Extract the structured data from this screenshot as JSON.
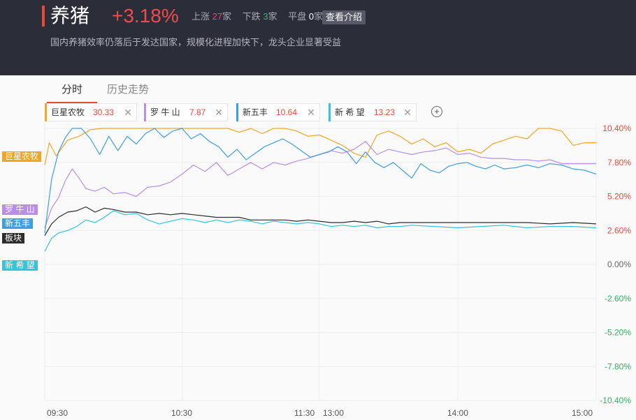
{
  "header": {
    "title": "养猪",
    "change": "+3.18%",
    "stats": {
      "up_label": "上涨",
      "up_count": "27",
      "up_unit": "家",
      "down_label": "下跌",
      "down_count": "3",
      "down_unit": "家",
      "flat_label": "平盘",
      "flat_count": "0",
      "flat_unit": "家"
    },
    "intro_button": "查看介绍",
    "description": "国内养猪效率仍落后于发达国家，规模化进程加快下，龙头企业显著受益"
  },
  "tabs": [
    {
      "label": "分时",
      "active": true
    },
    {
      "label": "历史走势",
      "active": false
    }
  ],
  "chips": [
    {
      "name": "巨星农牧",
      "value": "30.33",
      "color": "#f4a623"
    },
    {
      "name": "罗 牛 山",
      "value": "7.87",
      "color": "#b88ee6"
    },
    {
      "name": "新五丰",
      "value": "10.64",
      "color": "#3d9ee2"
    },
    {
      "name": "新 希 望",
      "value": "13.23",
      "color": "#36c3dc"
    }
  ],
  "add_symbol": "+",
  "close_symbol": "✕",
  "legend": [
    {
      "label": "巨星农牧",
      "color": "#f4a623"
    },
    {
      "label": "罗 牛 山",
      "color": "#b88ee6"
    },
    {
      "label": "新五丰",
      "color": "#3d9ee2"
    },
    {
      "label": "板块",
      "color": "#2d2d2d"
    },
    {
      "label": "新 希 望",
      "color": "#36c3dc"
    }
  ],
  "chart_data": {
    "type": "line",
    "x_ticks": [
      "09:30",
      "10:30",
      "11:30",
      "13:00",
      "14:00",
      "15:00"
    ],
    "y_ticks": [
      "10.40%",
      "7.80%",
      "5.20%",
      "2.60%",
      "0.00%",
      "-2.60%",
      "-5.20%",
      "-7.80%",
      "-10.40%"
    ],
    "ylim": [
      -10.4,
      10.4
    ],
    "grid": true,
    "colors": {
      "positive": "#e84a3a",
      "zero": "#666666",
      "negative": "#2fb164"
    },
    "series": [
      {
        "name": "巨星农牧",
        "color": "#f4a623",
        "points": [
          [
            0,
            7.6
          ],
          [
            2,
            9.3
          ],
          [
            5,
            8.3
          ],
          [
            10,
            9.5
          ],
          [
            15,
            9.8
          ],
          [
            20,
            10.3
          ],
          [
            25,
            10.4
          ],
          [
            30,
            10.4
          ],
          [
            35,
            10.4
          ],
          [
            40,
            10.4
          ],
          [
            45,
            10.4
          ],
          [
            50,
            10.4
          ],
          [
            55,
            10.4
          ],
          [
            60,
            10.4
          ],
          [
            65,
            10.4
          ],
          [
            70,
            10.4
          ],
          [
            75,
            10.4
          ],
          [
            80,
            10.4
          ],
          [
            85,
            10.1
          ],
          [
            90,
            10.4
          ],
          [
            95,
            10.0
          ],
          [
            100,
            10.4
          ],
          [
            105,
            10.4
          ],
          [
            110,
            10.2
          ],
          [
            115,
            9.8
          ],
          [
            120,
            9.9
          ],
          [
            125,
            9.5
          ],
          [
            130,
            9.1
          ],
          [
            135,
            8.5
          ],
          [
            140,
            8.2
          ],
          [
            145,
            9.9
          ],
          [
            150,
            10.2
          ],
          [
            155,
            9.8
          ],
          [
            160,
            9.2
          ],
          [
            165,
            9.6
          ],
          [
            170,
            9.0
          ],
          [
            175,
            9.3
          ],
          [
            180,
            8.6
          ],
          [
            185,
            8.8
          ],
          [
            190,
            8.5
          ],
          [
            195,
            9.2
          ],
          [
            200,
            9.5
          ],
          [
            205,
            9.8
          ],
          [
            210,
            9.6
          ],
          [
            215,
            10.4
          ],
          [
            220,
            10.4
          ],
          [
            225,
            10.2
          ],
          [
            230,
            9.1
          ],
          [
            235,
            9.3
          ],
          [
            240,
            9.3
          ]
        ]
      },
      {
        "name": "罗 牛 山",
        "color": "#b88ee6",
        "points": [
          [
            0,
            2.8
          ],
          [
            3,
            4.3
          ],
          [
            6,
            5.1
          ],
          [
            9,
            6.4
          ],
          [
            12,
            7.3
          ],
          [
            15,
            6.6
          ],
          [
            18,
            5.8
          ],
          [
            22,
            5.6
          ],
          [
            26,
            5.9
          ],
          [
            30,
            5.4
          ],
          [
            35,
            5.5
          ],
          [
            40,
            5.2
          ],
          [
            45,
            5.9
          ],
          [
            50,
            6.0
          ],
          [
            55,
            6.3
          ],
          [
            60,
            6.9
          ],
          [
            65,
            7.6
          ],
          [
            70,
            7.1
          ],
          [
            75,
            7.8
          ],
          [
            80,
            6.8
          ],
          [
            85,
            7.3
          ],
          [
            90,
            7.8
          ],
          [
            95,
            7.3
          ],
          [
            100,
            7.8
          ],
          [
            105,
            7.6
          ],
          [
            110,
            7.9
          ],
          [
            115,
            8.1
          ],
          [
            120,
            8.4
          ],
          [
            125,
            8.7
          ],
          [
            130,
            8.5
          ],
          [
            135,
            8.8
          ],
          [
            140,
            9.4
          ],
          [
            145,
            8.4
          ],
          [
            150,
            8.8
          ],
          [
            155,
            8.6
          ],
          [
            160,
            8.4
          ],
          [
            165,
            8.6
          ],
          [
            170,
            8.7
          ],
          [
            175,
            8.9
          ],
          [
            180,
            8.4
          ],
          [
            185,
            8.5
          ],
          [
            190,
            8.2
          ],
          [
            195,
            8.1
          ],
          [
            200,
            8.1
          ],
          [
            205,
            8.0
          ],
          [
            210,
            8.0
          ],
          [
            215,
            7.9
          ],
          [
            220,
            8.0
          ],
          [
            225,
            7.7
          ],
          [
            230,
            7.7
          ],
          [
            235,
            7.7
          ],
          [
            240,
            7.7
          ]
        ]
      },
      {
        "name": "新五丰",
        "color": "#3d9ee2",
        "points": [
          [
            0,
            2.4
          ],
          [
            3,
            6.5
          ],
          [
            6,
            8.6
          ],
          [
            9,
            9.7
          ],
          [
            12,
            10.4
          ],
          [
            16,
            10.4
          ],
          [
            20,
            9.6
          ],
          [
            24,
            8.4
          ],
          [
            28,
            9.8
          ],
          [
            32,
            8.7
          ],
          [
            36,
            9.8
          ],
          [
            40,
            9.2
          ],
          [
            44,
            10.0
          ],
          [
            48,
            10.4
          ],
          [
            52,
            9.7
          ],
          [
            56,
            10.2
          ],
          [
            60,
            10.4
          ],
          [
            64,
            9.6
          ],
          [
            68,
            10.0
          ],
          [
            72,
            9.4
          ],
          [
            76,
            9.0
          ],
          [
            80,
            8.2
          ],
          [
            84,
            8.8
          ],
          [
            88,
            8.0
          ],
          [
            92,
            8.5
          ],
          [
            96,
            9.0
          ],
          [
            100,
            9.3
          ],
          [
            104,
            9.6
          ],
          [
            108,
            9.2
          ],
          [
            112,
            8.7
          ],
          [
            116,
            8.2
          ],
          [
            120,
            8.4
          ],
          [
            124,
            8.6
          ],
          [
            128,
            9.0
          ],
          [
            132,
            8.6
          ],
          [
            136,
            7.7
          ],
          [
            140,
            8.6
          ],
          [
            144,
            7.8
          ],
          [
            148,
            7.4
          ],
          [
            152,
            7.8
          ],
          [
            156,
            7.2
          ],
          [
            160,
            6.6
          ],
          [
            164,
            7.7
          ],
          [
            168,
            7.2
          ],
          [
            172,
            7.0
          ],
          [
            176,
            7.5
          ],
          [
            180,
            7.7
          ],
          [
            184,
            7.8
          ],
          [
            188,
            7.5
          ],
          [
            192,
            7.3
          ],
          [
            196,
            7.6
          ],
          [
            200,
            7.3
          ],
          [
            205,
            7.4
          ],
          [
            210,
            7.6
          ],
          [
            215,
            7.4
          ],
          [
            220,
            7.7
          ],
          [
            225,
            7.6
          ],
          [
            230,
            7.3
          ],
          [
            235,
            7.2
          ],
          [
            240,
            6.9
          ]
        ]
      },
      {
        "name": "板块",
        "color": "#2d2d2d",
        "points": [
          [
            0,
            2.2
          ],
          [
            3,
            3.1
          ],
          [
            6,
            3.6
          ],
          [
            10,
            4.0
          ],
          [
            14,
            4.1
          ],
          [
            18,
            4.4
          ],
          [
            22,
            4.0
          ],
          [
            26,
            4.3
          ],
          [
            30,
            4.2
          ],
          [
            35,
            4.0
          ],
          [
            40,
            4.0
          ],
          [
            45,
            3.8
          ],
          [
            50,
            3.9
          ],
          [
            55,
            3.8
          ],
          [
            60,
            3.9
          ],
          [
            65,
            3.8
          ],
          [
            70,
            3.7
          ],
          [
            75,
            3.6
          ],
          [
            80,
            3.6
          ],
          [
            85,
            3.6
          ],
          [
            90,
            3.4
          ],
          [
            95,
            3.4
          ],
          [
            100,
            3.4
          ],
          [
            105,
            3.4
          ],
          [
            110,
            3.3
          ],
          [
            115,
            3.4
          ],
          [
            120,
            3.3
          ],
          [
            125,
            3.2
          ],
          [
            130,
            3.2
          ],
          [
            135,
            3.3
          ],
          [
            140,
            3.2
          ],
          [
            145,
            3.3
          ],
          [
            150,
            3.1
          ],
          [
            155,
            3.2
          ],
          [
            160,
            3.2
          ],
          [
            170,
            3.2
          ],
          [
            180,
            3.2
          ],
          [
            190,
            3.2
          ],
          [
            200,
            3.2
          ],
          [
            210,
            3.2
          ],
          [
            220,
            3.1
          ],
          [
            230,
            3.2
          ],
          [
            240,
            3.1
          ]
        ]
      },
      {
        "name": "新 希 望",
        "color": "#36c3dc",
        "points": [
          [
            0,
            1.0
          ],
          [
            3,
            2.0
          ],
          [
            6,
            2.4
          ],
          [
            10,
            2.6
          ],
          [
            14,
            2.9
          ],
          [
            18,
            3.4
          ],
          [
            22,
            3.2
          ],
          [
            26,
            3.6
          ],
          [
            30,
            4.1
          ],
          [
            35,
            3.8
          ],
          [
            40,
            3.9
          ],
          [
            45,
            3.4
          ],
          [
            50,
            3.1
          ],
          [
            55,
            3.3
          ],
          [
            60,
            3.5
          ],
          [
            65,
            3.4
          ],
          [
            70,
            3.2
          ],
          [
            75,
            3.4
          ],
          [
            80,
            3.2
          ],
          [
            85,
            3.4
          ],
          [
            90,
            3.3
          ],
          [
            95,
            3.1
          ],
          [
            100,
            3.3
          ],
          [
            105,
            3.2
          ],
          [
            110,
            3.1
          ],
          [
            115,
            3.2
          ],
          [
            120,
            3.1
          ],
          [
            125,
            2.9
          ],
          [
            130,
            3.0
          ],
          [
            135,
            2.9
          ],
          [
            140,
            3.0
          ],
          [
            145,
            2.8
          ],
          [
            150,
            2.9
          ],
          [
            155,
            2.9
          ],
          [
            160,
            3.0
          ],
          [
            170,
            2.9
          ],
          [
            180,
            2.8
          ],
          [
            190,
            2.9
          ],
          [
            200,
            3.0
          ],
          [
            210,
            2.8
          ],
          [
            220,
            2.9
          ],
          [
            230,
            2.9
          ],
          [
            240,
            2.8
          ]
        ]
      }
    ]
  }
}
